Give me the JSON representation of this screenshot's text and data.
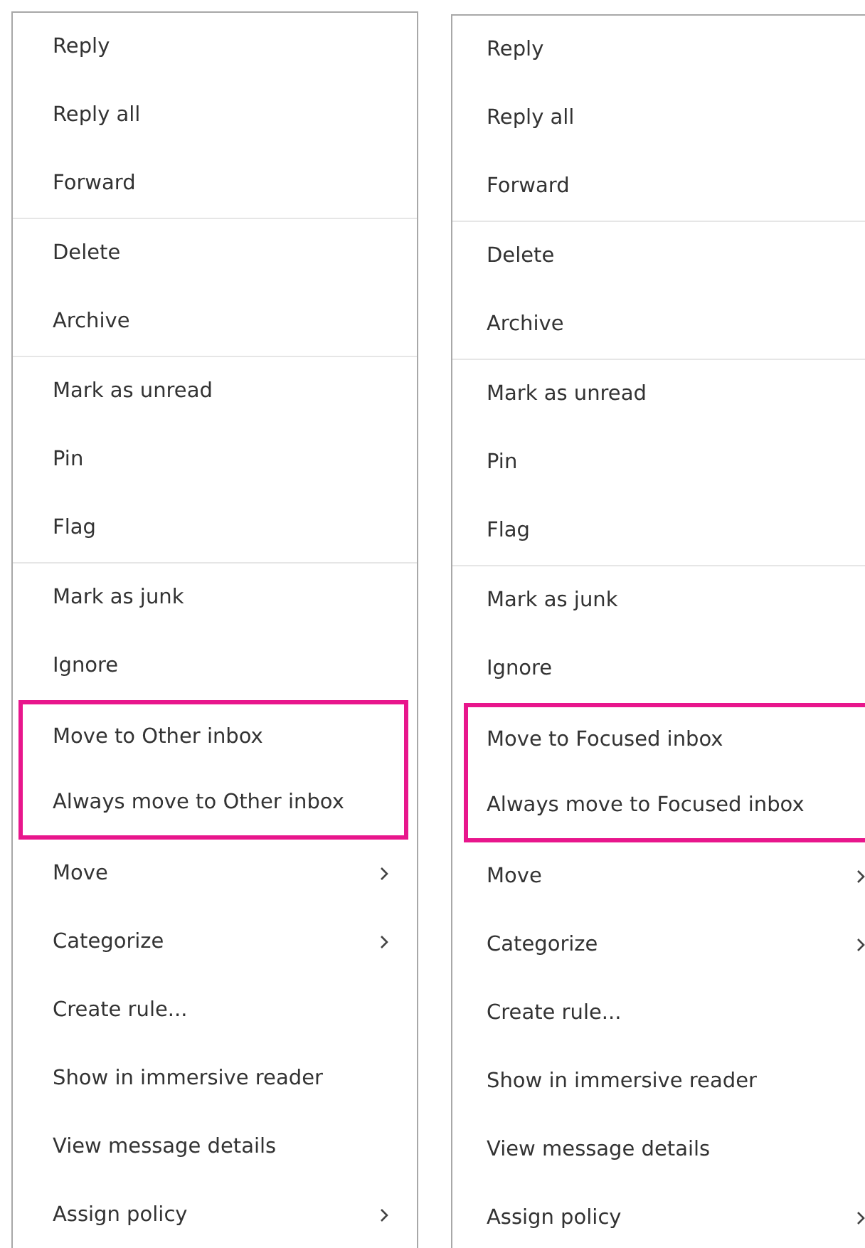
{
  "menus": [
    {
      "groups": [
        {
          "items": [
            {
              "label": "Reply",
              "submenu": false,
              "highlighted": false
            },
            {
              "label": "Reply all",
              "submenu": false,
              "highlighted": false
            },
            {
              "label": "Forward",
              "submenu": false,
              "highlighted": false
            }
          ]
        },
        {
          "items": [
            {
              "label": "Delete",
              "submenu": false,
              "highlighted": false
            },
            {
              "label": "Archive",
              "submenu": false,
              "highlighted": false
            }
          ]
        },
        {
          "items": [
            {
              "label": "Mark as unread",
              "submenu": false,
              "highlighted": false
            },
            {
              "label": "Pin",
              "submenu": false,
              "highlighted": false
            },
            {
              "label": "Flag",
              "submenu": false,
              "highlighted": false
            }
          ]
        },
        {
          "items": [
            {
              "label": "Mark as junk",
              "submenu": false,
              "highlighted": false
            },
            {
              "label": "Ignore",
              "submenu": false,
              "highlighted": false
            },
            {
              "label": "Move to Other inbox",
              "submenu": false,
              "highlighted": true
            },
            {
              "label": "Always move to Other inbox",
              "submenu": false,
              "highlighted": true
            },
            {
              "label": "Move",
              "submenu": true,
              "highlighted": false
            },
            {
              "label": "Categorize",
              "submenu": true,
              "highlighted": false
            },
            {
              "label": "Create rule...",
              "submenu": false,
              "highlighted": false
            },
            {
              "label": "Show in immersive reader",
              "submenu": false,
              "highlighted": false
            },
            {
              "label": "View message details",
              "submenu": false,
              "highlighted": false
            },
            {
              "label": "Assign policy",
              "submenu": true,
              "highlighted": false
            }
          ]
        }
      ]
    },
    {
      "groups": [
        {
          "items": [
            {
              "label": "Reply",
              "submenu": false,
              "highlighted": false
            },
            {
              "label": "Reply all",
              "submenu": false,
              "highlighted": false
            },
            {
              "label": "Forward",
              "submenu": false,
              "highlighted": false
            }
          ]
        },
        {
          "items": [
            {
              "label": "Delete",
              "submenu": false,
              "highlighted": false
            },
            {
              "label": "Archive",
              "submenu": false,
              "highlighted": false
            }
          ]
        },
        {
          "items": [
            {
              "label": "Mark as unread",
              "submenu": false,
              "highlighted": false
            },
            {
              "label": "Pin",
              "submenu": false,
              "highlighted": false
            },
            {
              "label": "Flag",
              "submenu": false,
              "highlighted": false
            }
          ]
        },
        {
          "items": [
            {
              "label": "Mark as junk",
              "submenu": false,
              "highlighted": false
            },
            {
              "label": "Ignore",
              "submenu": false,
              "highlighted": false
            },
            {
              "label": "Move to Focused inbox",
              "submenu": false,
              "highlighted": true
            },
            {
              "label": "Always move to Focused inbox",
              "submenu": false,
              "highlighted": true
            },
            {
              "label": "Move",
              "submenu": true,
              "highlighted": false
            },
            {
              "label": "Categorize",
              "submenu": true,
              "highlighted": false
            },
            {
              "label": "Create rule...",
              "submenu": false,
              "highlighted": false
            },
            {
              "label": "Show in immersive reader",
              "submenu": false,
              "highlighted": false
            },
            {
              "label": "View message details",
              "submenu": false,
              "highlighted": false
            },
            {
              "label": "Assign policy",
              "submenu": true,
              "highlighted": false
            }
          ]
        }
      ]
    }
  ]
}
